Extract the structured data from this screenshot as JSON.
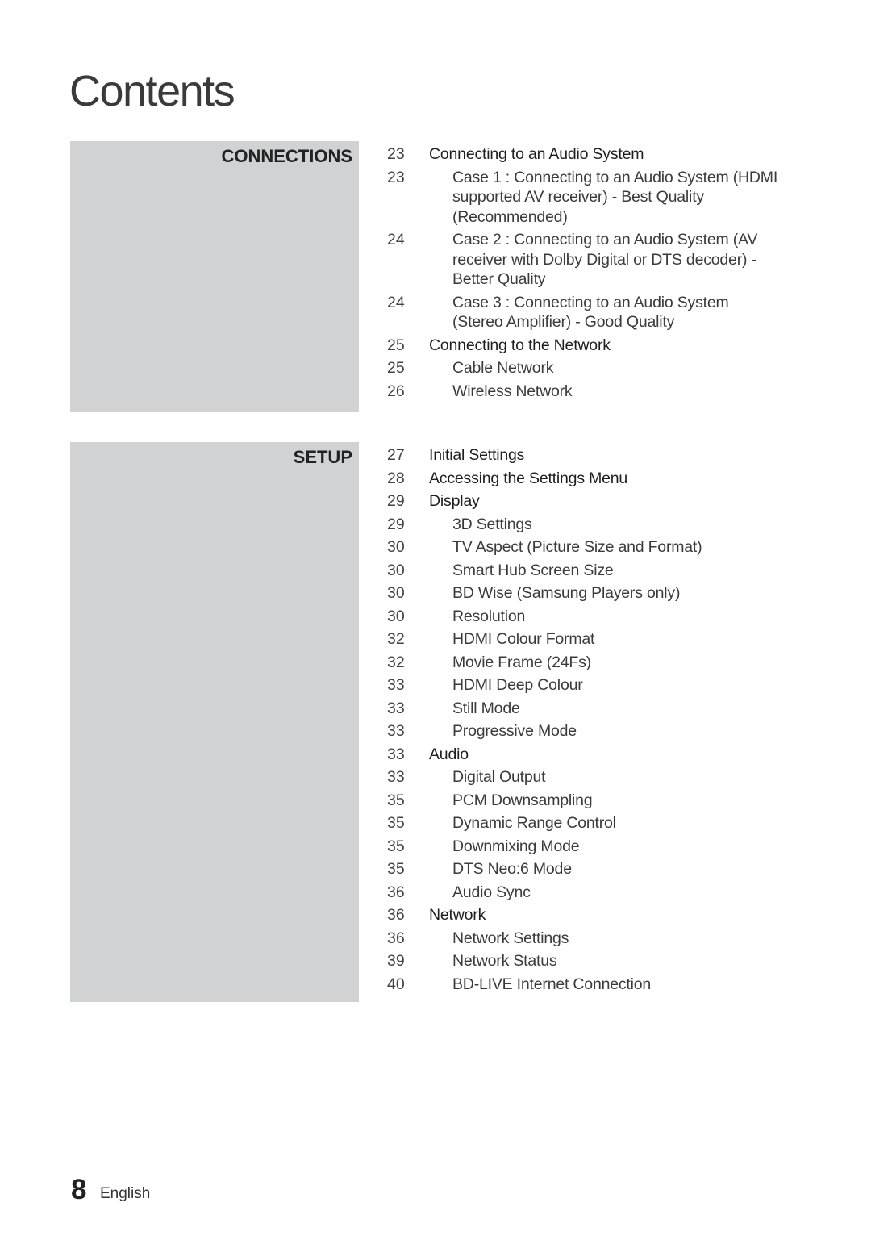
{
  "page": {
    "title": "Contents",
    "footer": {
      "page_number": "8",
      "language": "English"
    },
    "panel_color": "#d1d2d4"
  },
  "sections": [
    {
      "label": "CONNECTIONS",
      "entries": [
        {
          "page": "23",
          "level": 1,
          "text": "Connecting to an Audio System"
        },
        {
          "page": "23",
          "level": 2,
          "text": "Case 1 : Connecting to an Audio System (HDMI supported AV receiver) - Best Quality (Recommended)"
        },
        {
          "page": "24",
          "level": 2,
          "text": "Case 2 : Connecting to an Audio System (AV receiver with Dolby Digital or DTS decoder) - Better Quality"
        },
        {
          "page": "24",
          "level": 2,
          "text": "Case 3 : Connecting to an Audio System (Stereo Amplifier) - Good Quality"
        },
        {
          "page": "25",
          "level": 1,
          "text": "Connecting to the Network"
        },
        {
          "page": "25",
          "level": 2,
          "text": "Cable Network"
        },
        {
          "page": "26",
          "level": 2,
          "text": "Wireless Network"
        }
      ]
    },
    {
      "label": "SETUP",
      "entries": [
        {
          "page": "27",
          "level": 1,
          "text": "Initial Settings"
        },
        {
          "page": "28",
          "level": 1,
          "text": "Accessing the Settings Menu"
        },
        {
          "page": "29",
          "level": 1,
          "text": "Display"
        },
        {
          "page": "29",
          "level": 2,
          "text": "3D Settings"
        },
        {
          "page": "30",
          "level": 2,
          "text": "TV Aspect (Picture Size and Format)"
        },
        {
          "page": "30",
          "level": 2,
          "text": "Smart Hub Screen Size"
        },
        {
          "page": "30",
          "level": 2,
          "text": "BD Wise (Samsung Players only)"
        },
        {
          "page": "30",
          "level": 2,
          "text": "Resolution"
        },
        {
          "page": "32",
          "level": 2,
          "text": "HDMI Colour Format"
        },
        {
          "page": "32",
          "level": 2,
          "text": "Movie Frame (24Fs)"
        },
        {
          "page": "33",
          "level": 2,
          "text": "HDMI Deep Colour"
        },
        {
          "page": "33",
          "level": 2,
          "text": "Still Mode"
        },
        {
          "page": "33",
          "level": 2,
          "text": "Progressive Mode"
        },
        {
          "page": "33",
          "level": 1,
          "text": "Audio"
        },
        {
          "page": "33",
          "level": 2,
          "text": "Digital Output"
        },
        {
          "page": "35",
          "level": 2,
          "text": "PCM Downsampling"
        },
        {
          "page": "35",
          "level": 2,
          "text": "Dynamic Range Control"
        },
        {
          "page": "35",
          "level": 2,
          "text": "Downmixing Mode"
        },
        {
          "page": "35",
          "level": 2,
          "text": "DTS Neo:6 Mode"
        },
        {
          "page": "36",
          "level": 2,
          "text": "Audio Sync"
        },
        {
          "page": "36",
          "level": 1,
          "text": "Network"
        },
        {
          "page": "36",
          "level": 2,
          "text": "Network Settings"
        },
        {
          "page": "39",
          "level": 2,
          "text": "Network Status"
        },
        {
          "page": "40",
          "level": 2,
          "text": "BD-LIVE Internet Connection"
        }
      ]
    }
  ]
}
